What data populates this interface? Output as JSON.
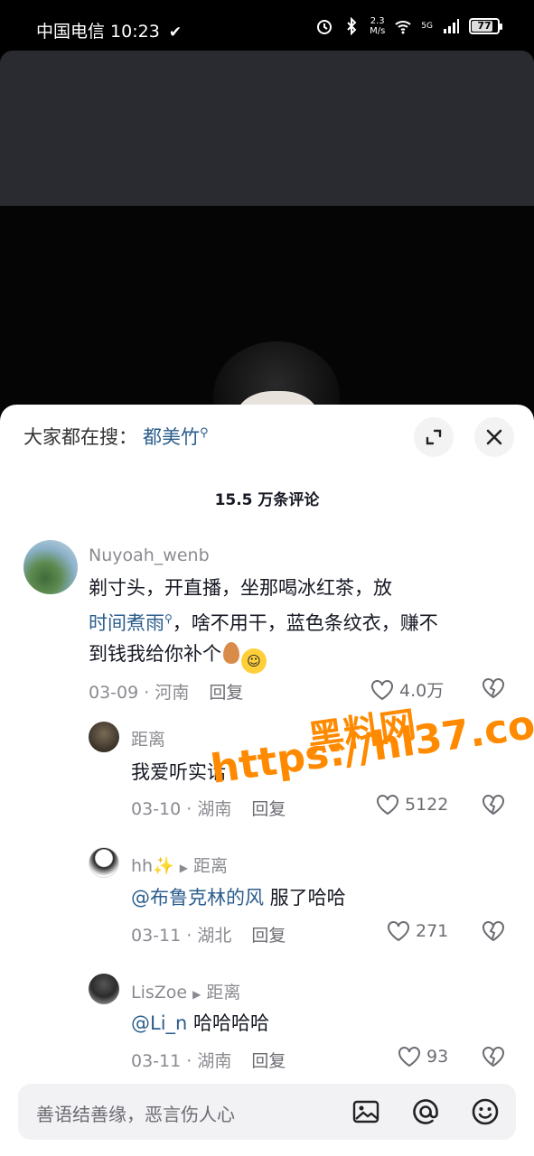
{
  "status_bar": {
    "carrier_time": "中国电信 10:23",
    "net_speed": "2.3",
    "net_unit": "M/s",
    "signal": "5G",
    "battery": "77"
  },
  "sheet": {
    "search_prefix": "大家都在搜：",
    "search_keyword": "都美竹",
    "comment_count": "15.5 万条评论"
  },
  "comments": [
    {
      "username": "Nuyoah_wenb",
      "line1": "剃寸头，开直播，坐那喝冰红茶，放",
      "link": "时间煮雨",
      "line2_rest": "，啥不用干，蓝色条纹衣，赚不",
      "line3": "到钱我给你补个",
      "date_loc": "03-09 · 河南",
      "reply": "回复",
      "likes": "4.0万"
    },
    {
      "username": "距离",
      "text": "我爱听实话",
      "date_loc": "03-10 · 湖南",
      "reply": "回复",
      "likes": "5122"
    },
    {
      "username": "hh✨",
      "reply_to": "距离",
      "mention": "@布鲁克林的风",
      "text": " 服了哈哈",
      "date_loc": "03-11 · 湖北",
      "reply": "回复",
      "likes": "271"
    },
    {
      "username": "LisZoe",
      "reply_to": "距离",
      "mention": "@Li_n",
      "text": " 哈哈哈哈",
      "date_loc": "03-11 · 湖南",
      "reply": "回复",
      "likes": "93"
    }
  ],
  "watermark": {
    "line1": "黑料网",
    "line2": "https://hl37.co"
  },
  "input": {
    "placeholder": "善语结善缘，恶言伤人心"
  },
  "colors": {
    "link": "#2b5d8c",
    "watermark": "#ff8a00",
    "muted": "#8a8b91"
  }
}
